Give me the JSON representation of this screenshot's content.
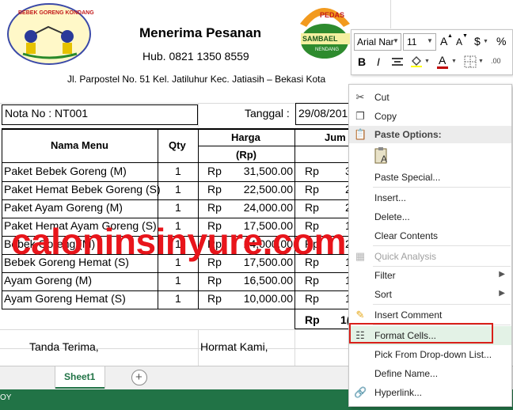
{
  "header": {
    "logo_left_text": "BEBEK GORENG KONDANG",
    "title": "Menerima Pesanan",
    "phone": "Hub. 0821 1350 8559",
    "address": "Jl. Parpostel No. 51 Kel. Jatiluhur Kec. Jatiasih – Bekasi Kota",
    "logo_right_top": "PEDAS",
    "logo_right_mid": "SAMBAEL",
    "logo_right_bottom": "NENDANG"
  },
  "nota": {
    "label": "Nota No : NT001",
    "tanggal_label": "Tanggal :",
    "tanggal_value": "29/08/201"
  },
  "table": {
    "col_menu": "Nama Menu",
    "col_qty": "Qty",
    "col_harga": "Harga",
    "col_harga_unit": "(Rp)",
    "col_jumlah": "Jum",
    "rows": [
      {
        "menu": "Paket Bebek Goreng (M)",
        "qty": "1",
        "rp": "Rp",
        "harga": "31,500.00",
        "rp2": "Rp",
        "jumlah": "3"
      },
      {
        "menu": "Paket Hemat Bebek Goreng (S)",
        "qty": "1",
        "rp": "Rp",
        "harga": "22,500.00",
        "rp2": "Rp",
        "jumlah": "2"
      },
      {
        "menu": "Paket Ayam Goreng (M)",
        "qty": "1",
        "rp": "Rp",
        "harga": "24,000.00",
        "rp2": "Rp",
        "jumlah": "2"
      },
      {
        "menu": "Paket Hemat Ayam Goreng (S)",
        "qty": "1",
        "rp": "Rp",
        "harga": "17,500.00",
        "rp2": "Rp",
        "jumlah": "1"
      },
      {
        "menu": "Bebek Goreng (M)",
        "qty": "1",
        "rp": "Rp",
        "harga": "24,000.00",
        "rp2": "Rp",
        "jumlah": "2"
      },
      {
        "menu": "Bebek Goreng Hemat (S)",
        "qty": "1",
        "rp": "Rp",
        "harga": "17,500.00",
        "rp2": "Rp",
        "jumlah": "1"
      },
      {
        "menu": "Ayam Goreng (M)",
        "qty": "1",
        "rp": "Rp",
        "harga": "16,500.00",
        "rp2": "Rp",
        "jumlah": "1"
      },
      {
        "menu": "Ayam Goreng Hemat (S)",
        "qty": "1",
        "rp": "Rp",
        "harga": "10,000.00",
        "rp2": "Rp",
        "jumlah": "1"
      }
    ],
    "total_rp": "Rp",
    "total_value": "1("
  },
  "footer": {
    "tanda_terima": "Tanda Terima,",
    "hormat_kami": "Hormat Kami,"
  },
  "watermark": "caloninsinyure.com",
  "sheet_tabs": {
    "active": "Sheet1",
    "add_label": "+"
  },
  "status_bar": {
    "text": "OY"
  },
  "mini_toolbar": {
    "font_name": "Arial Nar",
    "font_size": "11",
    "grow_label": "A",
    "shrink_label": "A",
    "currency_label": "$",
    "percent_label": "%",
    "bold_label": "B",
    "italic_label": "I",
    "font_color_label": "A"
  },
  "context_menu": {
    "cut": "Cut",
    "copy": "Copy",
    "paste_options": "Paste Options:",
    "paste_special": "Paste Special...",
    "insert": "Insert...",
    "delete": "Delete...",
    "clear_contents": "Clear Contents",
    "quick_analysis": "Quick Analysis",
    "filter": "Filter",
    "sort": "Sort",
    "insert_comment": "Insert Comment",
    "format_cells": "Format Cells...",
    "pick_dropdown": "Pick From Drop-down List...",
    "define_name": "Define Name...",
    "hyperlink": "Hyperlink..."
  },
  "colors": {
    "highlight_box": "#d9201a",
    "watermark": "#e8151b",
    "status_bar": "#217346",
    "sheet_tab_text": "#217346"
  }
}
